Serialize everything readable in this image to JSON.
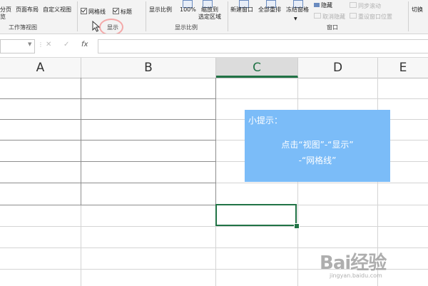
{
  "ribbon": {
    "workbook_views": {
      "b1_line1": "分页",
      "b1_line2": "览",
      "b2": "页面布局",
      "b3": "自定义视图",
      "group": "工作簿视图"
    },
    "show": {
      "gridlines": "网格线",
      "headings": "标题",
      "group": "显示"
    },
    "zoom": {
      "b1": "显示比例",
      "b2": "100%",
      "b3_line1": "缩放到",
      "b3_line2": "选定区域",
      "group": "显示比例"
    },
    "window": {
      "new": "新建窗口",
      "arrange": "全部重排",
      "freeze": "冻结窗格",
      "hide": "隐藏",
      "unhide": "取消隐藏",
      "sync_scroll": "同步滚动",
      "reset_pos": "重设窗口位置",
      "switch": "切换",
      "group": "窗口"
    }
  },
  "formula_bar": {
    "fx": "fx"
  },
  "columns": [
    "A",
    "B",
    "C",
    "D",
    "E"
  ],
  "selected_column": "C",
  "tip": {
    "title": "小提示：",
    "line1": "点击“视图”-“显示”",
    "line2": "-“网格线”",
    "bg": "#7bbcf8"
  },
  "watermark": {
    "brand": "Bai经验",
    "url": "jingyan.baidu.com"
  },
  "colors": {
    "excel_green": "#217346"
  }
}
